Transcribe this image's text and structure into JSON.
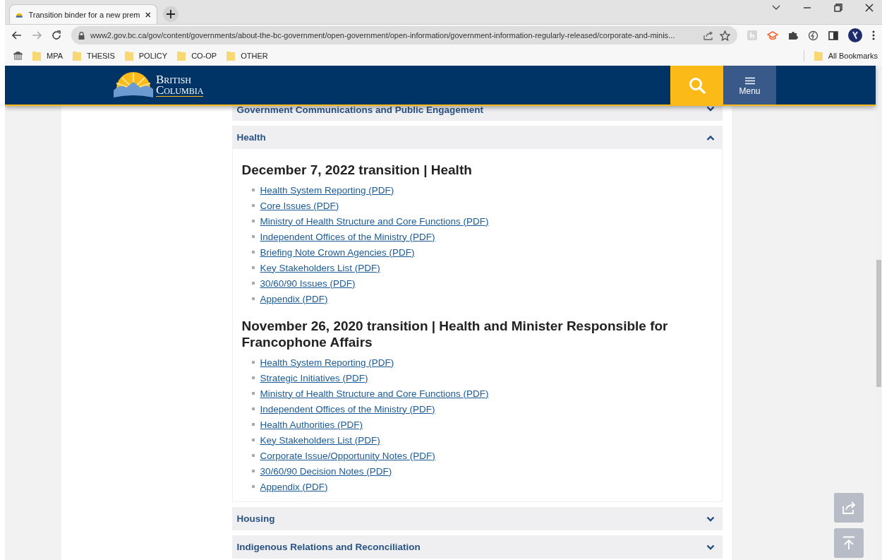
{
  "browser": {
    "tab": {
      "title": "Transition binder for a new prem",
      "selected": true
    },
    "address": "www2.gov.bc.ca/gov/content/governments/about-the-bc-government/open-government/open-information/government-information-regularly-released/corporate-and-minis...",
    "bookmarks": [
      {
        "label": "MPA"
      },
      {
        "label": "THESIS"
      },
      {
        "label": "POLICY"
      },
      {
        "label": "CO-OP"
      },
      {
        "label": "OTHER"
      }
    ],
    "all_bookmarks": "All Bookmarks"
  },
  "header": {
    "logo_line1": "British",
    "logo_line2": "Columbia",
    "menu_label": "Menu"
  },
  "accordions": [
    {
      "title": "Government Communications and Public Engagement",
      "expanded": false
    },
    {
      "title": "Health",
      "expanded": true,
      "sections": [
        {
          "heading": "December 7, 2022 transition | Health",
          "links": [
            "Health System Reporting (PDF)",
            "Core Issues (PDF)",
            "Ministry of Health Structure and Core Functions (PDF)",
            "Independent Offices of the Ministry (PDF)",
            "Briefing Note Crown Agencies (PDF)",
            "Key Stakeholders List (PDF)",
            "30/60/90 Issues (PDF)",
            "Appendix (PDF)"
          ]
        },
        {
          "heading": "November 26, 2020 transition | Health and Minister Responsible for Francophone Affairs",
          "links": [
            "Health System Reporting (PDF)",
            "Strategic Initiatives (PDF)",
            "Ministry of Health Structure and Core Functions (PDF)",
            "Independent Offices of the Ministry (PDF)",
            "Health Authorities (PDF)",
            "Key Stakeholders List (PDF)",
            "Corporate Issue/Opportunity Notes (PDF)",
            "30/60/90 Decision Notes (PDF)",
            "Appendix (PDF)"
          ]
        }
      ]
    },
    {
      "title": "Housing",
      "expanded": false
    },
    {
      "title": "Indigenous Relations and Reconciliation",
      "expanded": false
    }
  ]
}
